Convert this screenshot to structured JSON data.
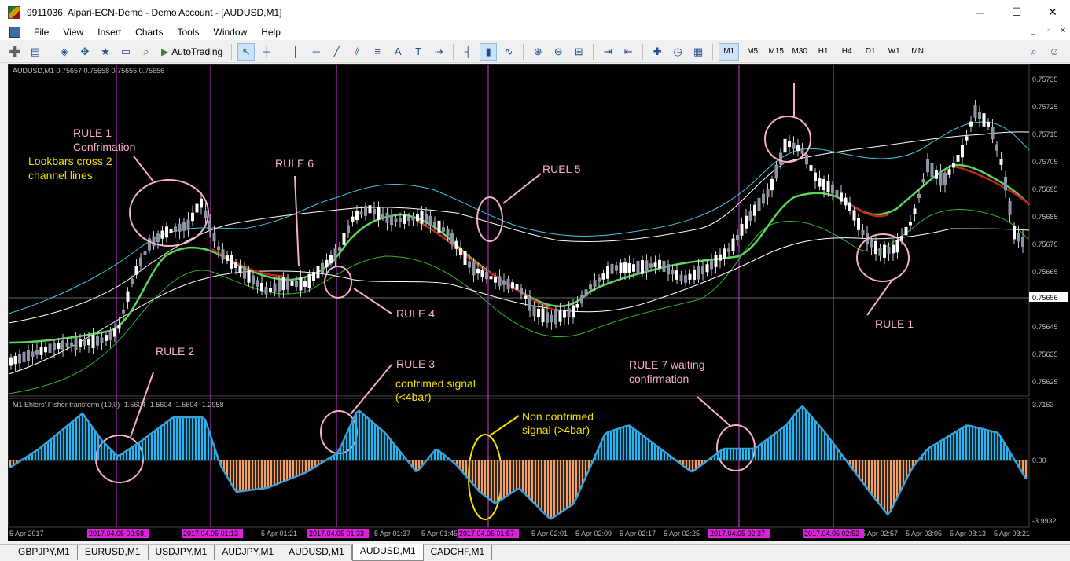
{
  "window": {
    "title": "9911036: Alpari-ECN-Demo - Demo Account - [AUDUSD,M1]",
    "minimize": "─",
    "maximize": "☐",
    "close": "✕"
  },
  "menu": [
    "File",
    "View",
    "Insert",
    "Charts",
    "Tools",
    "Window",
    "Help"
  ],
  "mdi": {
    "min": "_",
    "restore": "▫",
    "close": "✕"
  },
  "toolbar": {
    "autotrading": "AutoTrading",
    "timeframes": [
      "M1",
      "M5",
      "M15",
      "M30",
      "H1",
      "H4",
      "D1",
      "W1",
      "MN"
    ]
  },
  "chart": {
    "header": "AUDUSD,M1  0.75657 0.75658 0.75655 0.75656",
    "price_ticks": [
      "0.75735",
      "0.75725",
      "0.75715",
      "0.75705",
      "0.75695",
      "0.75685",
      "0.75675",
      "0.75665",
      "0.75655",
      "0.75645",
      "0.75635",
      "0.75625"
    ],
    "current_price": "0.75656",
    "indicator_header": "M1 Ehlers' Fisher transform (10,0) -1.5604 -1.5604 -1.5604 -1.2958",
    "indicator_ticks": [
      "3.7163",
      "0.00",
      "-3.9932"
    ],
    "time_labels": [
      "5 Apr 2017",
      "5 Apr 01:21",
      "5 Apr 01:37",
      "5 Apr 01:45",
      "5 Apr 02:01",
      "5 Apr 02:09",
      "5 Apr 02:17",
      "5 Apr 02:25",
      "5 Apr 02:57",
      "5 Apr 03:05",
      "5 Apr 03:13",
      "5 Apr 03:21"
    ],
    "time_markers": [
      "2017.04.05 00:58",
      "2017.04.05 01:13",
      "2017.04.05 01:33",
      "2017.04.05 01:57",
      "2017.04.05 02:37",
      "2017.04.05 02:52"
    ],
    "annotations": {
      "rule1_title": "RULE 1",
      "rule1_sub": "Confrimation",
      "lookbars_1": "Lookbars cross 2",
      "lookbars_2": "channel lines",
      "rule6": "RULE 6",
      "ruel5": "RUEL 5",
      "rule4": "RULE 4",
      "rule1_right": "RULE 1",
      "rule2": "RULE 2",
      "rule3": "RULE 3",
      "confirmed_1": "confrimed signal",
      "confirmed_2": "(<4bar)",
      "nonconf_1": "Non confrimed",
      "nonconf_2": "signal  (>4bar)",
      "rule7_1": "RULE 7 waiting",
      "rule7_2": "confirmation"
    }
  },
  "tabs": [
    "GBPJPY,M1",
    "EURUSD,M1",
    "USDJPY,M1",
    "AUDJPY,M1",
    "AUDUSD,M1",
    "AUDUSD,M1",
    "CADCHF,M1"
  ],
  "active_tab": "AUDUSD,M1"
}
